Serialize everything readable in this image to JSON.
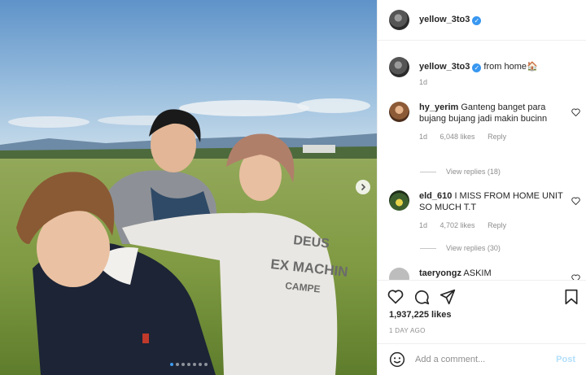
{
  "post": {
    "username": "yellow_3to3",
    "verified_icon": "verified-badge-icon",
    "image_alt": "Four young men standing in a green field under a blue sky",
    "carousel": {
      "total_slides": 7,
      "active_slide": 1
    }
  },
  "caption": {
    "username": "yellow_3to3",
    "text": "from home",
    "emoji": "🏠",
    "age": "1d"
  },
  "comments": [
    {
      "username": "hy_yerim",
      "text": "Ganteng banget para bujang bujang jadi makin bucinn",
      "age": "1d",
      "likes": "6,048 likes",
      "reply": "Reply",
      "view_replies": "View replies (18)"
    },
    {
      "username": "eld_610",
      "text": "I MISS FROM HOME UNIT SO MUCH T.T",
      "age": "1d",
      "likes": "4,702 likes",
      "reply": "Reply",
      "view_replies": "View replies (30)"
    },
    {
      "username": "taeryongz",
      "text": "ASKIM"
    }
  ],
  "actions": {
    "likes": "1,937,225 likes",
    "date": "1 DAY AGO"
  },
  "add_comment": {
    "placeholder": "Add a comment...",
    "post_label": "Post"
  },
  "colors": {
    "verified": "#3897f0",
    "link_disabled": "#b2dffc",
    "muted": "#8e8e8e",
    "text": "#262626"
  }
}
